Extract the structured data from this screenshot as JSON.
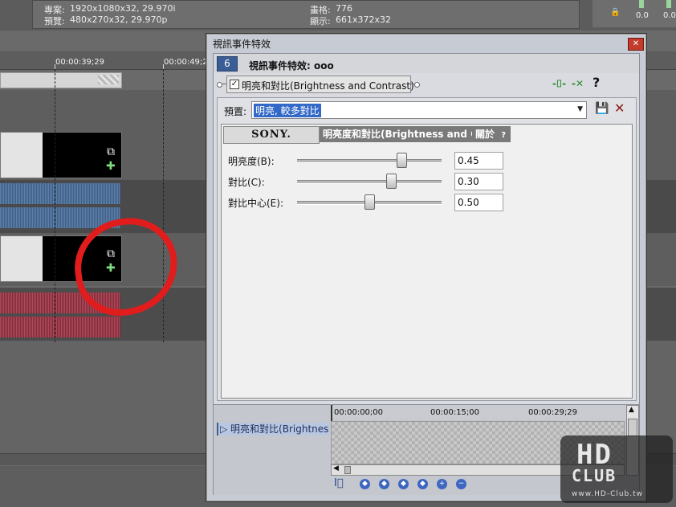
{
  "app_info": {
    "project_label": "專案:",
    "project_value": "1920x1080x32, 29.970i",
    "preview_label": "預覽:",
    "preview_value": "480x270x32, 29.970p",
    "frame_label": "畫格:",
    "frame_value": "776",
    "display_label": "顯示:",
    "display_value": "661x372x32"
  },
  "meters": {
    "left_value": "0.0",
    "right_value": "0.0"
  },
  "timeline": {
    "ruler_times": [
      "00:00:39;29",
      "00:00:49;2"
    ]
  },
  "dialog": {
    "title": "視訊事件特效",
    "close_icon": "close-icon",
    "header_number": "6",
    "header_title": "視訊事件特效: ooo",
    "fx_chain_item": "明亮和對比(Brightness and Contrast)",
    "fx_checked": true,
    "help_label": "?",
    "preset": {
      "label": "預置:",
      "value": "明亮, 較多對比",
      "save_icon": "floppy-save-icon",
      "delete_icon": "delete-x-icon"
    },
    "plugin": {
      "vendor_tab": "SONY.",
      "name_tab": "明亮度和對比(Brightness and C",
      "about_tab": "關於",
      "about_help": "?",
      "params": [
        {
          "label": "明亮度(B):",
          "value": "0.45",
          "fraction": 0.72
        },
        {
          "label": "對比(C):",
          "value": "0.30",
          "fraction": 0.65
        },
        {
          "label": "對比中心(E):",
          "value": "0.50",
          "fraction": 0.5
        }
      ]
    },
    "keyframes": {
      "track_label": "明亮和對比(Brightnes",
      "times": [
        "00:00:00;00",
        "00:00:15;00",
        "00:00:29;29"
      ],
      "buttons": [
        "first-keyframe",
        "prev-keyframe",
        "play",
        "next-keyframe",
        "add-keyframe",
        "remove-keyframe"
      ]
    }
  },
  "watermark": {
    "logo_text": "HD",
    "sub_text": "CLUB",
    "url_text": "www.HD-Club.tw"
  }
}
